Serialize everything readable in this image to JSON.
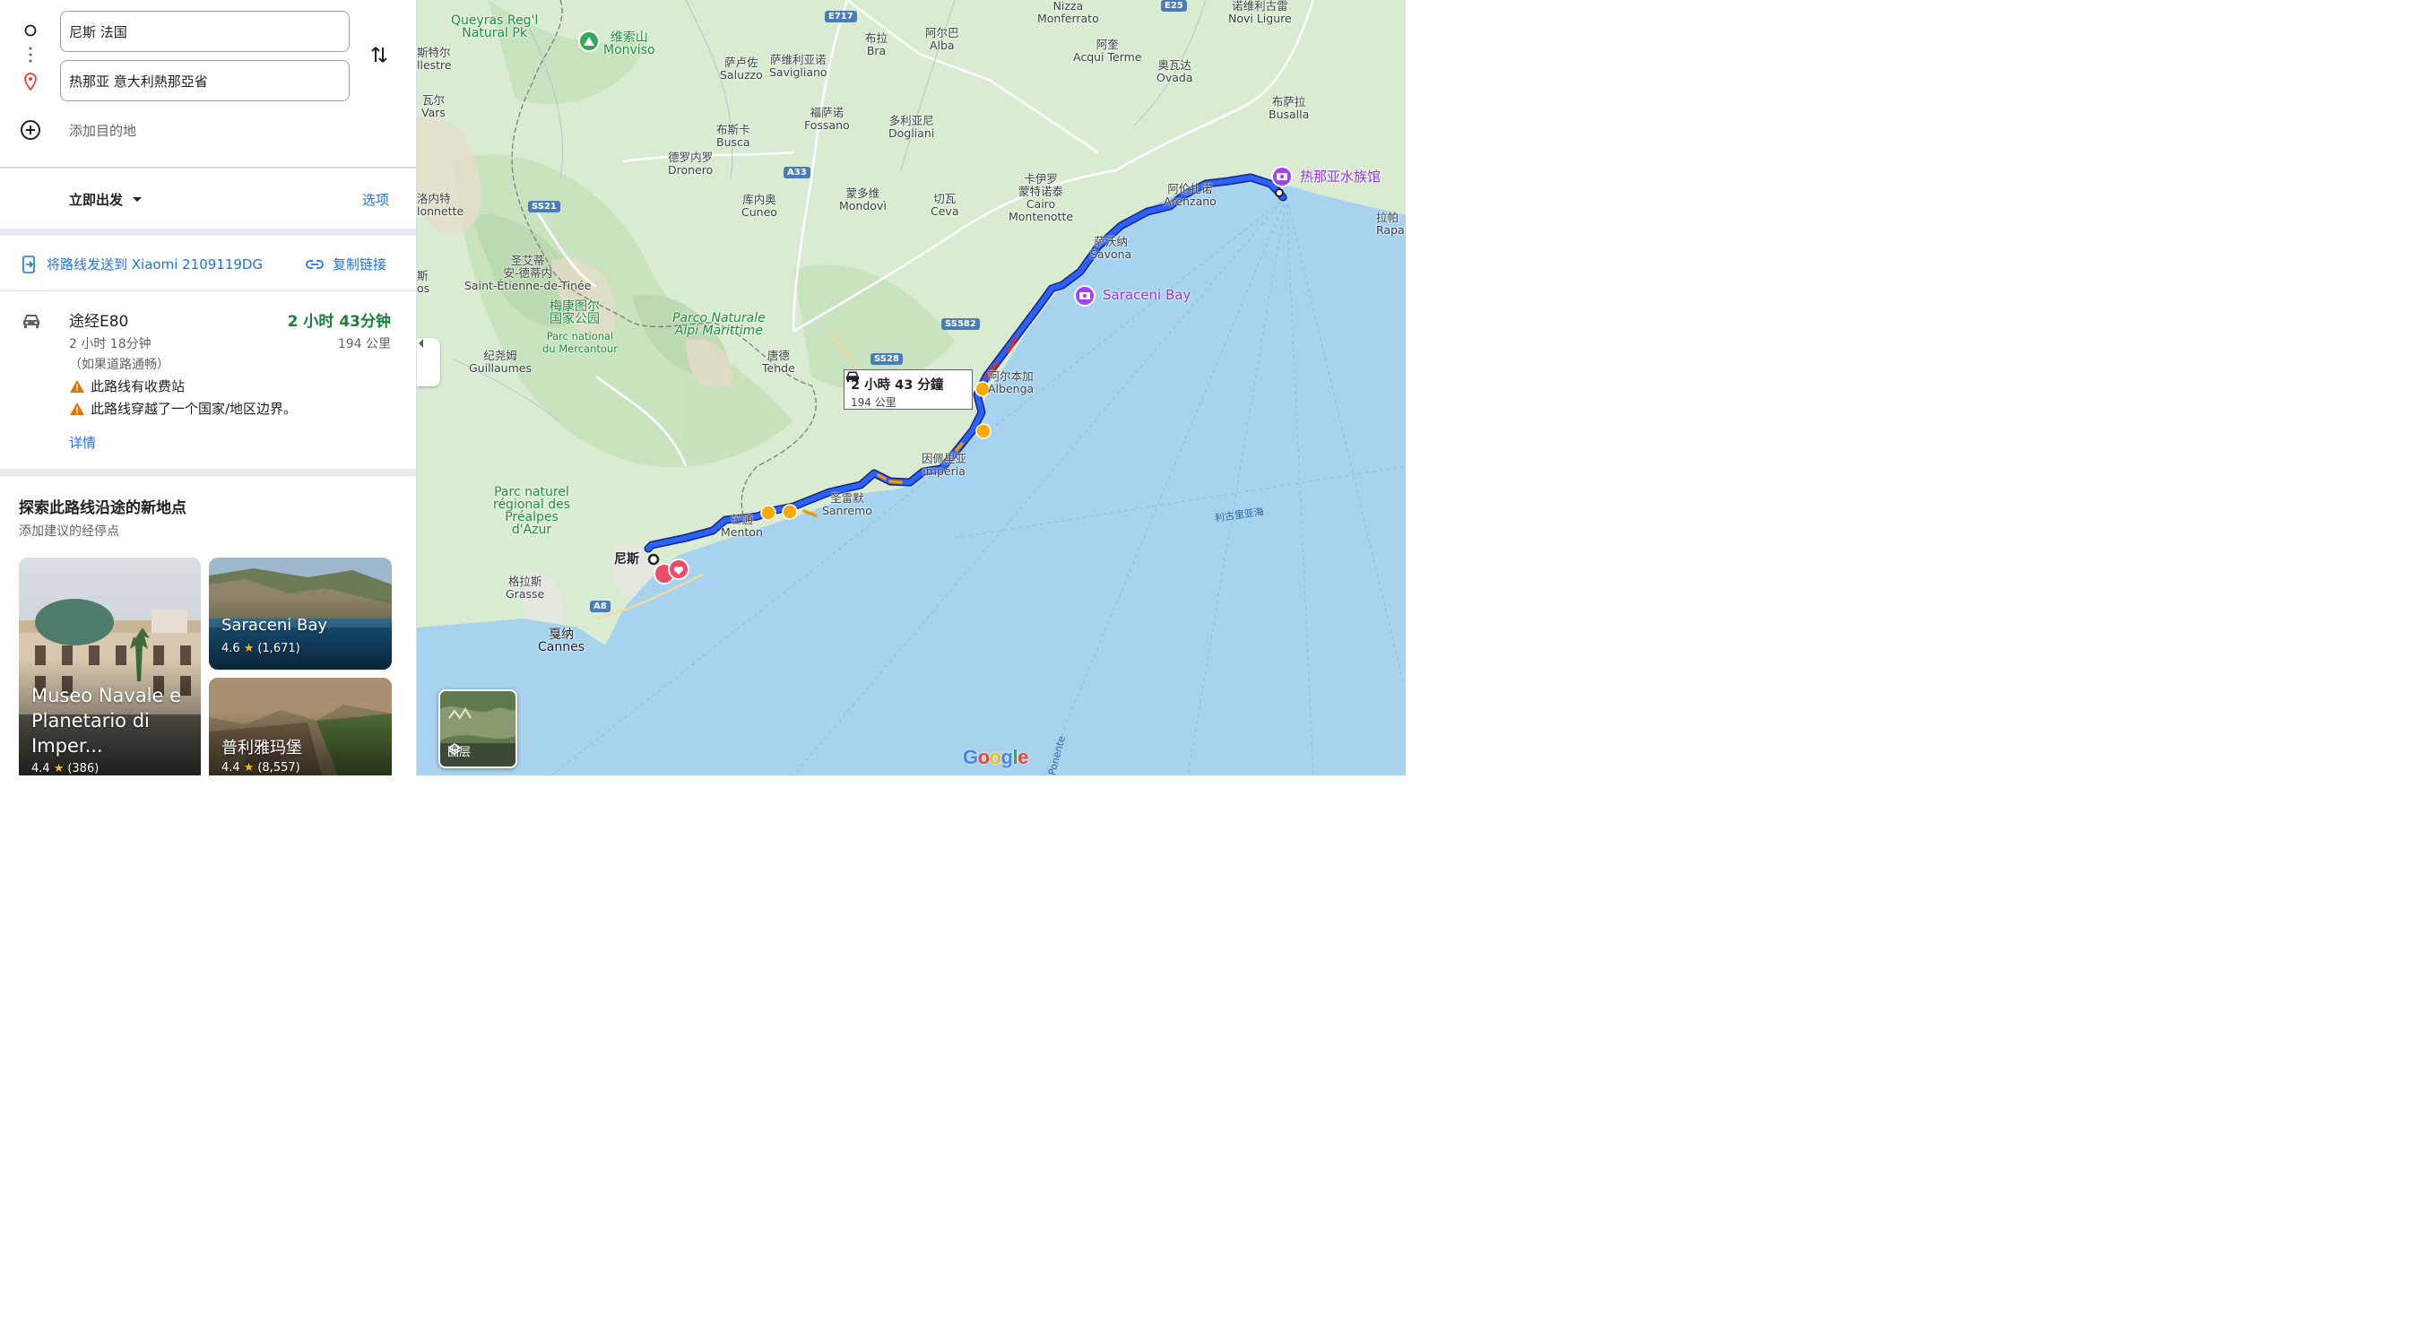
{
  "directions": {
    "origin_value": "尼斯 法国",
    "destination_value": "热那亚 意大利熱那亞省",
    "add_destination_label": "添加目的地",
    "depart_label": "立即出发",
    "options_label": "选项",
    "send_to_device_label": "将路线发送到 Xiaomi 2109119DG",
    "copy_link_label": "复制链接"
  },
  "route": {
    "via": "途经E80",
    "duration": "2 小时 43分钟",
    "typical_time": "2 小时 18分钟",
    "distance": "194 公里",
    "traffic_note": "（如果道路通畅）",
    "warnings": [
      "此路线有收费站",
      "此路线穿越了一个国家/地区边界。"
    ],
    "details_label": "详情"
  },
  "explore": {
    "title": "探索此路线沿途的新地点",
    "subtitle": "添加建议的经停点",
    "cards": [
      {
        "title_line1": "Museo Navale e",
        "title_line2": "Planetario di",
        "title_line3": "Imper...",
        "rating": "4.4",
        "reviews": "(386)"
      },
      {
        "title": "Saraceni Bay",
        "rating": "4.6",
        "reviews": "(1,671)"
      },
      {
        "title": "普利雅玛堡",
        "rating": "4.4",
        "reviews": "(8,557)"
      }
    ]
  },
  "map": {
    "route_box": {
      "duration": "2 小時 43 分鐘",
      "distance": "194 公里"
    },
    "layers_label": "图层",
    "google_logo": "Google",
    "labels": {
      "queyras": "Queyras Reg'l\nNatural Pk",
      "monviso": "维索山\nMonviso",
      "e717": "E717",
      "e25": "E25",
      "bra": "布拉\nBra",
      "alba": "阿尔巴\nAlba",
      "monferrato": "Nizza\nMonferrato",
      "novi": "诺维利古雷\nNovi Ligure",
      "estre": "斯特尔\nllestre",
      "saluzzo": "萨卢佐\nSaluzzo",
      "savigliano": "萨维利亚诺\nSavigliano",
      "acqui": "阿奎\nAcqui Terme",
      "ovada": "奥瓦达\nOvada",
      "vars": "瓦尔\nVars",
      "fossano": "福萨诺\nFossano",
      "dogliani": "多利亚尼\nDogliani",
      "busalla": "布萨拉\nBusalla",
      "busca": "布斯卡\nBusca",
      "dronero": "德罗内罗\nDronero",
      "a33": "A33",
      "cairo": "卡伊罗\n蒙特诺泰\nCairo\nMontenotte",
      "arenzano": "阿伦扎诺\nArenzano",
      "aquarium": "热那亚水族馆",
      "rapallo": "拉帕\nRapal",
      "lonnette": "洛内特\nlonnette",
      "ss21": "SS21",
      "cuneo": "库内奥\nCuneo",
      "mondovi": "蒙多维\nMondovì",
      "ceva": "切瓦\nCeva",
      "savona": "萨沃纳\nSavona",
      "stetienne": "圣艾蒂\n安-德蒂内\nSaint-Étienne-de-Tinée",
      "saraceni": "Saraceni Bay",
      "mercantour": "梅康图尔\n国家公园",
      "mercantour_fr": "Parc national\ndu Mercantour",
      "alpi": "Parco Naturale\nAlpi Marittime",
      "ss582": "SS582",
      "os": "斯\nos",
      "guillaumes": "纪尧姆\nGuillaumes",
      "tende": "唐德\nTende",
      "ss28": "SS28",
      "albenga": "阿尔本加\nAlbenga",
      "imperia": "因佩里亚\nImperia",
      "prealpes": "Parc naturel\nrégional des\nPréalpes\nd'Azur",
      "sanremo": "圣雷默\nSanremo",
      "ligurian": "利古里亚海",
      "menton": "芒通\nMenton",
      "nice": "尼斯",
      "grasse": "格拉斯\nGrasse",
      "a8": "A8",
      "cannes": "戛纳\nCannes",
      "ponente": "Ponente"
    }
  },
  "colors": {
    "route": "#2962ff",
    "sea": "#a7d3ef",
    "land": "#d9ecd1",
    "accent_green": "#188038",
    "link": "#1a73e8"
  }
}
